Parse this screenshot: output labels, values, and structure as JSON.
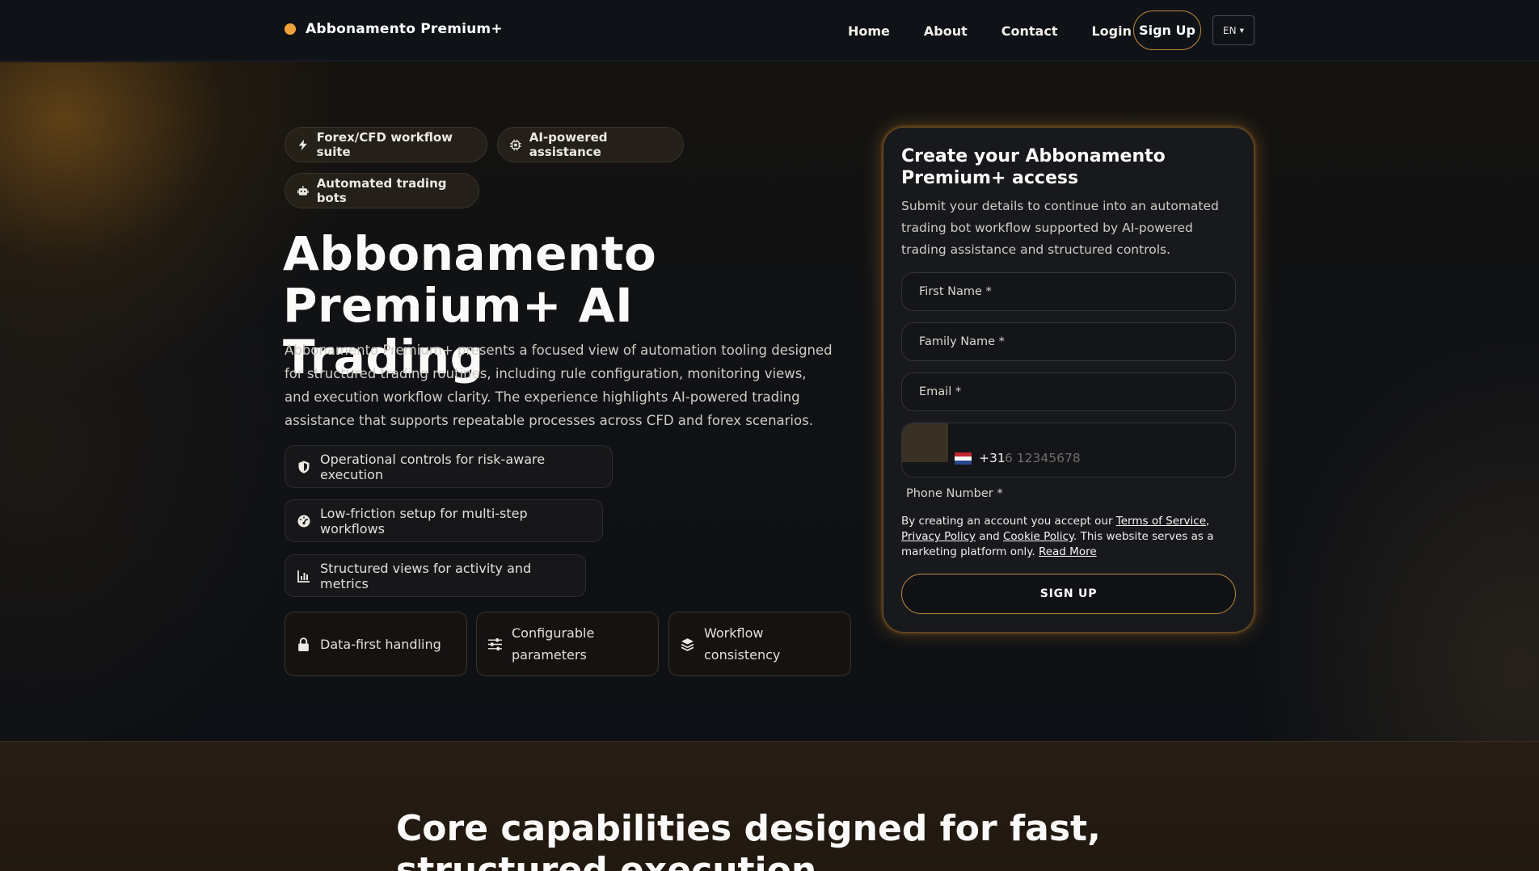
{
  "nav": {
    "brand": "Abbonamento Premium+",
    "links": [
      "Home",
      "About",
      "Contact",
      "Login"
    ],
    "signup": "Sign Up",
    "lang": "EN"
  },
  "hero": {
    "chips": [
      "Forex/CFD workflow suite",
      "AI-powered assistance",
      "Automated trading bots"
    ],
    "title_line1": "Abbonamento",
    "title_line2": "Premium+ AI Trading",
    "description": "Abbonamento Premium+ presents a focused view of automation tooling designed for structured trading routines, including rule configuration, monitoring views, and execution workflow clarity. The experience highlights AI-powered trading assistance that supports repeatable processes across CFD and forex scenarios.",
    "features": [
      "Operational controls for risk-aware execution",
      "Low-friction setup for multi-step workflows",
      "Structured views for activity and metrics"
    ],
    "tiles": [
      "Data-first handling",
      "Configurable parameters",
      "Workflow consistency"
    ]
  },
  "form": {
    "title": "Create your Abbonamento Premium+ access",
    "subtitle": "Submit your details to continue into an automated trading bot workflow supported by AI-powered trading assistance and structured controls.",
    "first_name": "First Name *",
    "family_name": "Family Name *",
    "email": "Email *",
    "phone_code": "+31",
    "phone_placeholder": "6 12345678",
    "phone_label": "Phone Number *",
    "legal_prefix": "By creating an account you accept our ",
    "terms": "Terms of Service",
    "privacy": "Privacy Policy",
    "and": " and ",
    "cookie": "Cookie Policy",
    "legal_suffix": ". This website serves as a marketing platform only. ",
    "read_more": "Read More",
    "submit": "SIGN UP"
  },
  "section2": {
    "title_line1": "Core capabilities designed for fast,",
    "title_line2": "structured execution"
  },
  "colors": {
    "accent": "#f0a23a",
    "border_accent": "#c08a3c",
    "background": "#0d1015"
  }
}
